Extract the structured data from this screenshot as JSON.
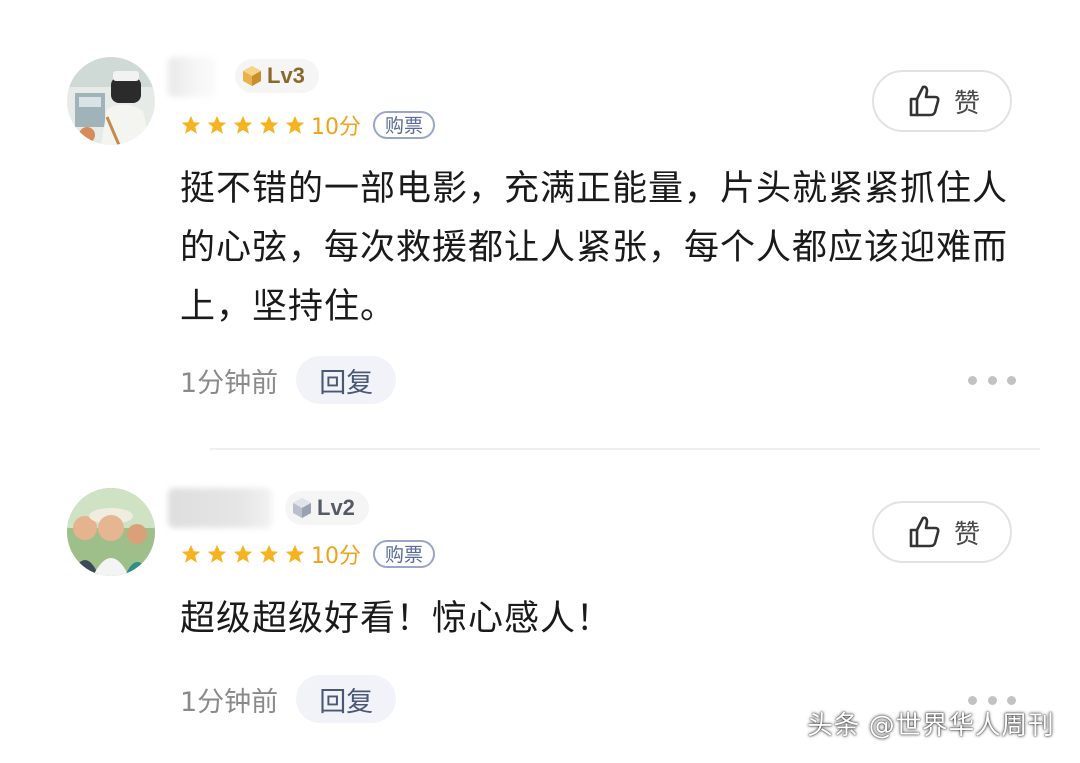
{
  "comments": [
    {
      "level": "Lv3",
      "score": "10分",
      "ticket": "购票",
      "like_label": "赞",
      "text": "挺不错的一部电影，充满正能量，片头就紧紧抓住人的心弦，每次救援都让人紧张，每个人都应该迎难而上，坚持住。",
      "time": "1分钟前",
      "reply": "回复",
      "star_count": 5
    },
    {
      "level": "Lv2",
      "score": "10分",
      "ticket": "购票",
      "like_label": "赞",
      "text": "超级超级好看！惊心感人！",
      "time": "1分钟前",
      "reply": "回复",
      "star_count": 5
    }
  ],
  "watermark": "头条 @世界华人周刊",
  "colors": {
    "star": "#f5b320",
    "score": "#f0a21b",
    "ticket_border": "#9aa6c8",
    "reply_bg": "#f1f3f8"
  },
  "icons": {
    "level": "cube-badge-icon",
    "like": "thumbs-up-icon",
    "more": "more-dots-icon",
    "star": "star-icon"
  }
}
